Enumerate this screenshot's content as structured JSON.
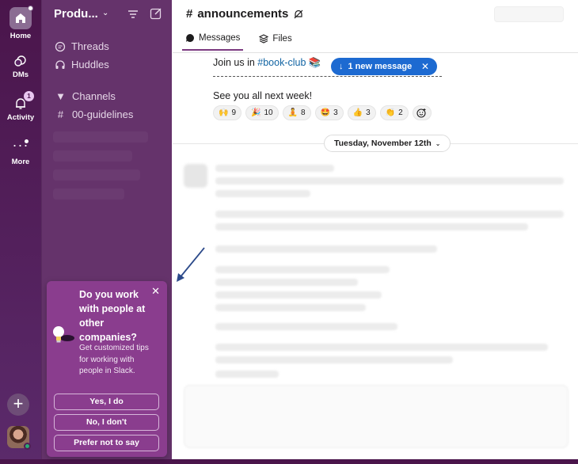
{
  "rail": {
    "home_label": "Home",
    "dms_label": "DMs",
    "activity_label": "Activity",
    "activity_badge": "1",
    "more_label": "More"
  },
  "sidebar": {
    "workspace_name": "Produ...",
    "items": [
      {
        "label": "Threads",
        "icon": "threads-icon"
      },
      {
        "label": "Huddles",
        "icon": "headphones-icon"
      }
    ],
    "channels_header": "Channels",
    "channels": [
      {
        "label": "00-guidelines"
      }
    ]
  },
  "channel": {
    "name": "announcements",
    "tabs": [
      {
        "label": "Messages",
        "active": true
      },
      {
        "label": "Files",
        "active": false
      }
    ]
  },
  "messages": {
    "join_prefix": "Join us in ",
    "join_link": "#book-club",
    "join_emoji": "📚",
    "closing": "See you all next week!",
    "reactions": [
      {
        "emoji": "🙌",
        "count": "9"
      },
      {
        "emoji": "🎉",
        "count": "10"
      },
      {
        "emoji": "🧘",
        "count": "8"
      },
      {
        "emoji": "🤩",
        "count": "3"
      },
      {
        "emoji": "👍",
        "count": "3"
      },
      {
        "emoji": "👏",
        "count": "2"
      }
    ]
  },
  "new_message_pill": "1 new message",
  "date_divider": "Tuesday, November 12th",
  "popup": {
    "title": "Do you work with people at other companies?",
    "body": "Get customized tips for working with people in Slack.",
    "buttons": [
      "Yes, I do",
      "No, I don't",
      "Prefer not to say"
    ]
  },
  "colors": {
    "rail_bg": "#4a154b",
    "sidebar_bg": "#65336b",
    "popup_bg": "#8a3d8e",
    "link": "#1264a3",
    "new_message_bg": "#1d6ad1"
  }
}
